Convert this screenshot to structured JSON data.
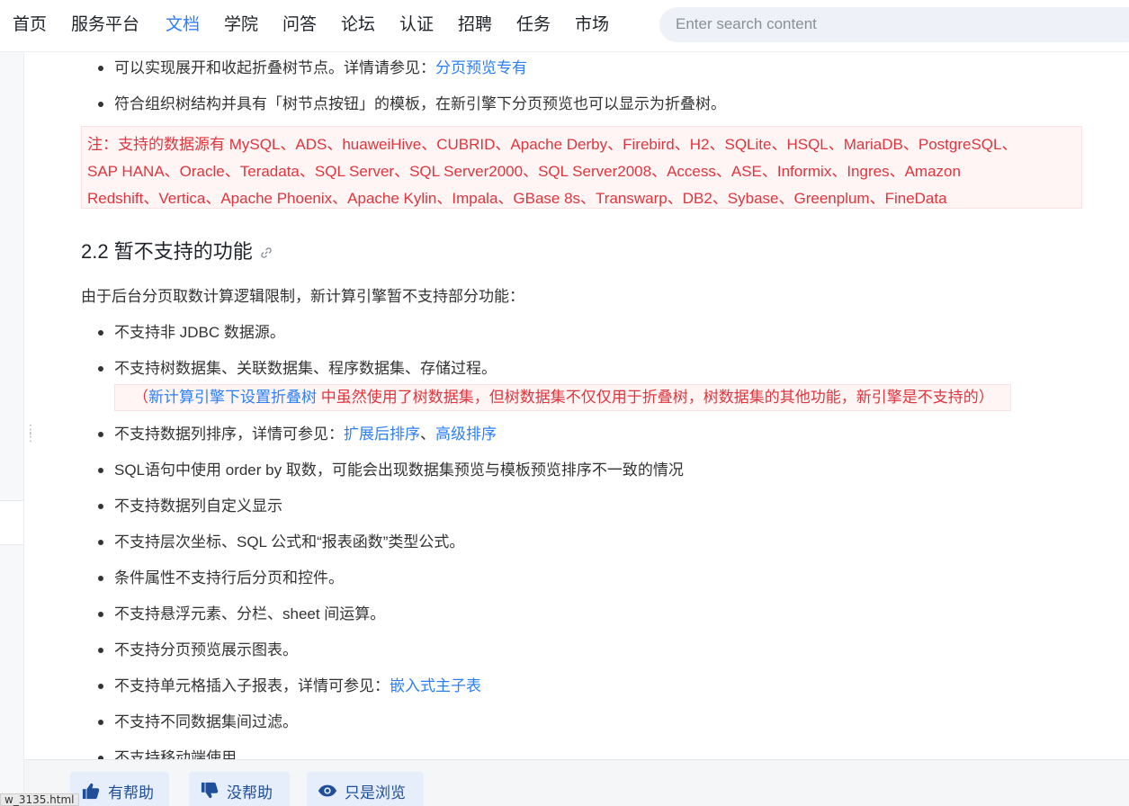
{
  "nav": {
    "items": [
      "首页",
      "服务平台",
      "文档",
      "学院",
      "问答",
      "论坛",
      "认证",
      "招聘",
      "任务",
      "市场"
    ],
    "active_index": 2,
    "search_placeholder": "Enter search content"
  },
  "content": {
    "bullets_top": [
      {
        "text": "可以实现展开和收起折叠树节点。详情请参见：",
        "link": "分页预览专有"
      },
      {
        "text": "符合组织树结构并具有「树节点按钮」的模板，在新引擎下分页预览也可以显示为折叠树。"
      }
    ],
    "note_lines": [
      "注：支持的数据源有 MySQL、ADS、huaweiHive、CUBRID、Apache Derby、Firebird、H2、SQLite、HSQL、MariaDB、PostgreSQL、",
      "SAP HANA、Oracle、Teradata、SQL Server、SQL Server2000、SQL Server2008、Access、ASE、Informix、Ingres、Amazon",
      "Redshift、Vertica、Apache Phoenix、Apache Kylin、Impala、GBase 8s、Transwarp、DB2、Sybase、Greenplum、FineData"
    ],
    "heading": "2.2 暂不支持的功能",
    "intro": "由于后台分页取数计算逻辑限制，新计算引擎暂不支持部分功能：",
    "unsupported": [
      "不支持非 JDBC 数据源。",
      "不支持树数据集、关联数据集、程序数据集、存储过程。",
      "不支持数据列排序，详情可参见：",
      "SQL语句中使用 order by 取数，可能会出现数据集预览与模板预览排序不一致的情况",
      "不支持数据列自定义显示",
      "不支持层次坐标、SQL 公式和“报表函数”类型公式。",
      "条件属性不支持行后分页和控件。",
      "不支持悬浮元素、分栏、sheet 间运算。",
      "不支持分页预览展示图表。",
      "不支持单元格插入子报表，详情可参见：",
      "不支持不同数据集间过滤。",
      "不支持移动端使用。"
    ],
    "sort_links": {
      "a": "扩展后排序",
      "sep": "、",
      "b": "高级排序"
    },
    "subreport_link": "嵌入式主子表",
    "tree_note": {
      "open": "（",
      "link": "新计算引擎下设置折叠树",
      "rest": " 中虽然使用了树数据集，但树数据集不仅仅用于折叠树，树数据集的其他功能，新引擎是不支持的）"
    }
  },
  "feedback": {
    "helpful": "有帮助",
    "not_helpful": "没帮助",
    "just_browse": "只是浏览"
  },
  "status_url": "w_3135.html",
  "colors": {
    "accent": "#2d7ff9",
    "note_red": "#e0353d",
    "note_bg": "#fff5f5",
    "text": "#333333"
  }
}
